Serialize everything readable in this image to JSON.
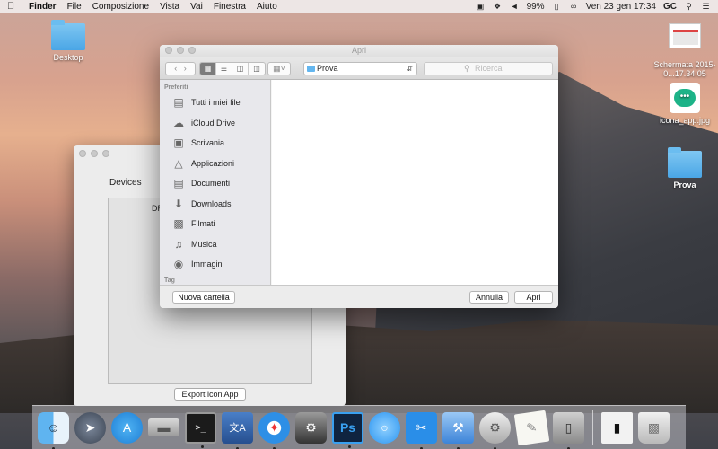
{
  "menubar": {
    "apple": "",
    "items": [
      "Finder",
      "File",
      "Composizione",
      "Vista",
      "Vai",
      "Finestra",
      "Aiuto"
    ],
    "battery": "99%",
    "datetime": "Ven 23 gen  17:34",
    "user": "GC"
  },
  "desktop": {
    "icons": [
      {
        "label": "Desktop"
      },
      {
        "label": "Schermata 2015-0...17.34.05"
      },
      {
        "label": "icona_app.jpg"
      },
      {
        "label": "Prova"
      }
    ]
  },
  "back_window": {
    "devices_label": "Devices",
    "box_label": "DR",
    "export_button": "Export icon App"
  },
  "dialog": {
    "title": "Apri",
    "location": "Prova",
    "search_placeholder": "Ricerca",
    "favorites_header": "Preferiti",
    "tags_header": "Tag",
    "sidebar_items": [
      {
        "label": "Tutti i miei file",
        "icon": "all-files-icon"
      },
      {
        "label": "iCloud Drive",
        "icon": "cloud-icon"
      },
      {
        "label": "Scrivania",
        "icon": "desktop-icon"
      },
      {
        "label": "Applicazioni",
        "icon": "applications-icon"
      },
      {
        "label": "Documenti",
        "icon": "documents-icon"
      },
      {
        "label": "Downloads",
        "icon": "downloads-icon"
      },
      {
        "label": "Filmati",
        "icon": "movies-icon"
      },
      {
        "label": "Musica",
        "icon": "music-icon"
      },
      {
        "label": "Immagini",
        "icon": "pictures-icon"
      }
    ],
    "new_folder": "Nuova cartella",
    "cancel": "Annulla",
    "open": "Apri"
  }
}
